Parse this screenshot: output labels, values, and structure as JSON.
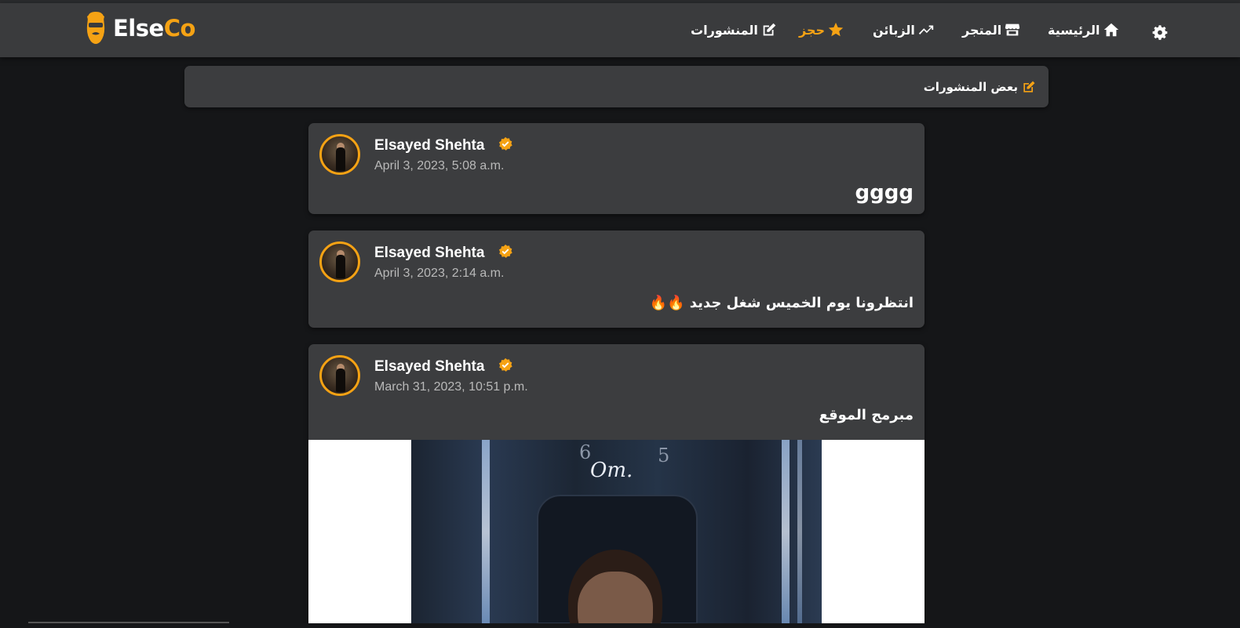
{
  "brand": {
    "part1": "Else",
    "part2": "Co"
  },
  "nav": {
    "items": [
      {
        "label": "الرئيسية",
        "icon": "home-icon"
      },
      {
        "label": "المتجر",
        "icon": "store-icon"
      },
      {
        "label": "الزبائن",
        "icon": "trend-up-icon"
      },
      {
        "label": "حجز",
        "icon": "star-icon",
        "active": true
      },
      {
        "label": "المنشورات",
        "icon": "edit-icon"
      }
    ],
    "settings_icon": "gear-icon"
  },
  "section": {
    "title": "بعض المنشورات",
    "icon": "edit-icon"
  },
  "posts": [
    {
      "author": "Elsayed Shehta",
      "date": "April 3, 2023, 5:08 a.m.",
      "content": "gggg"
    },
    {
      "author": "Elsayed Shehta",
      "date": "April 3, 2023, 2:14 a.m.",
      "content": "انتظرونا يوم الخميس شغل جديد 🔥🔥"
    },
    {
      "author": "Elsayed Shehta",
      "date": "March 31, 2023, 10:51 p.m.",
      "content": "مبرمج الموقع",
      "has_image": true
    }
  ],
  "colors": {
    "accent": "#f5a214",
    "navbar": "#3a3b3d",
    "card": "#3c3d3f",
    "background": "#151618"
  }
}
